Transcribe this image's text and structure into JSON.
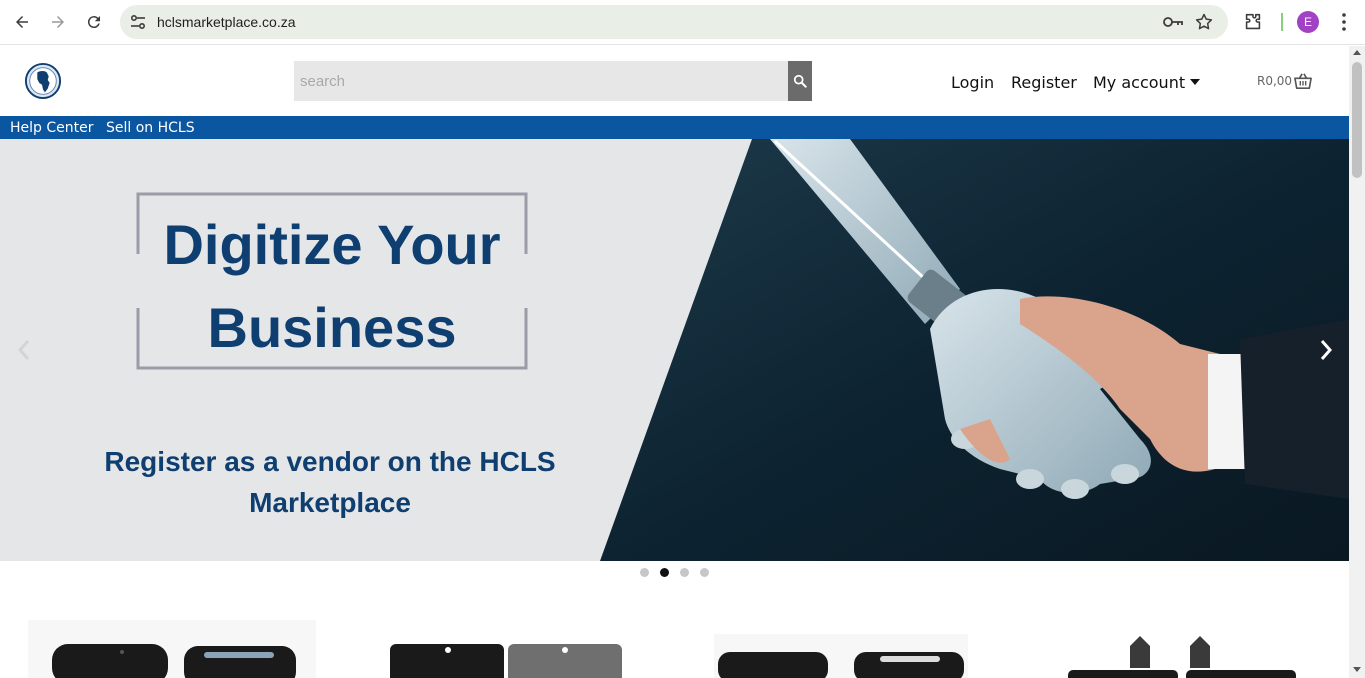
{
  "browser": {
    "url": "hclsmarketplace.co.za",
    "profile_initial": "E",
    "profile_color": "#a142c5"
  },
  "header": {
    "search_placeholder": "search",
    "nav": {
      "login": "Login",
      "register": "Register",
      "my_account": "My account"
    },
    "cart_total": "R0,00"
  },
  "subnav": {
    "items": [
      "Help Center",
      "Sell on HCLS"
    ],
    "color": "#0b56a0"
  },
  "hero": {
    "headline_line1": "Digitize Your",
    "headline_line2": "Business",
    "subline1": "Register as a vendor on the HCLS",
    "subline2": "Marketplace",
    "text_color": "#0f3e70",
    "slides_count": 4,
    "active_slide": 2
  },
  "icons": [
    "back-icon",
    "forward-icon",
    "reload-icon",
    "site-info-icon",
    "password-key-icon",
    "bookmark-star-icon",
    "extensions-icon",
    "menu-kebab-icon",
    "logo-globe-icon",
    "search-icon",
    "cart-basket-icon",
    "chevron-left-icon",
    "chevron-right-icon"
  ]
}
